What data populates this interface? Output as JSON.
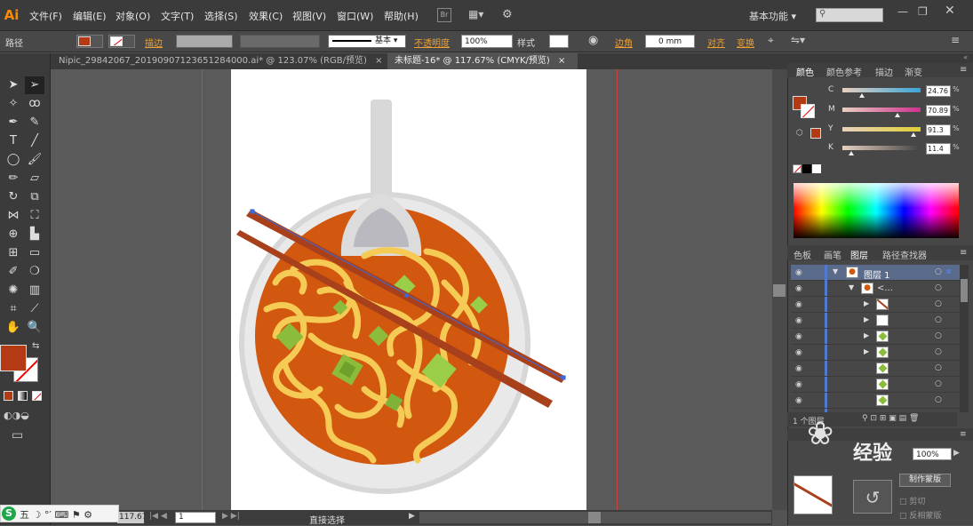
{
  "app": {
    "logo": "Ai"
  },
  "menu": [
    "文件(F)",
    "编辑(E)",
    "对象(O)",
    "文字(T)",
    "选择(S)",
    "效果(C)",
    "视图(V)",
    "窗口(W)",
    "帮助(H)"
  ],
  "workspace": "基本功能",
  "control": {
    "path_label": "路径",
    "stroke_label": "描边",
    "opacity_label": "不透明度",
    "opacity_value": "100%",
    "style_label": "样式",
    "brush_label": "基本",
    "corner_label": "边角",
    "corner_value": "0 mm",
    "align_label": "对齐",
    "transform_label": "变换"
  },
  "tabs": [
    {
      "label": "Nipic_29842067_20190907123651284000.ai* @ 123.07% (RGB/预览)",
      "close": "×"
    },
    {
      "label": "未标题-16* @ 117.67% (CMYK/预览)",
      "close": "×"
    }
  ],
  "color_panel": {
    "tabs": [
      "颜色",
      "颜色参考",
      "描边",
      "渐变"
    ],
    "channels": [
      {
        "name": "C",
        "value": "24.76",
        "level": 0.25,
        "color": "#3aa5d8"
      },
      {
        "name": "M",
        "value": "70.89",
        "level": 0.71,
        "color": "#d03090"
      },
      {
        "name": "Y",
        "value": "91.3",
        "level": 0.91,
        "color": "#e0d030"
      },
      {
        "name": "K",
        "value": "11.4",
        "level": 0.11,
        "color": "#444444"
      }
    ],
    "fill_color": "#b33a12"
  },
  "layers_panel": {
    "tabs": [
      "色板",
      "画笔",
      "图层",
      "路径查找器"
    ],
    "top_layer": "图层 1",
    "group_label": "<...",
    "count": "1 个图层"
  },
  "transparency": {
    "value": "100%",
    "make_mask": "制作蒙版",
    "clip": "剪切",
    "invert": "反相蒙版"
  },
  "status": {
    "zoom": "117.67%",
    "page": "1",
    "tool": "直接选择"
  },
  "ime": {
    "items": [
      "五",
      "☽",
      "°′",
      "⌨",
      "⚑",
      "⚙"
    ]
  },
  "watermark": "经验"
}
